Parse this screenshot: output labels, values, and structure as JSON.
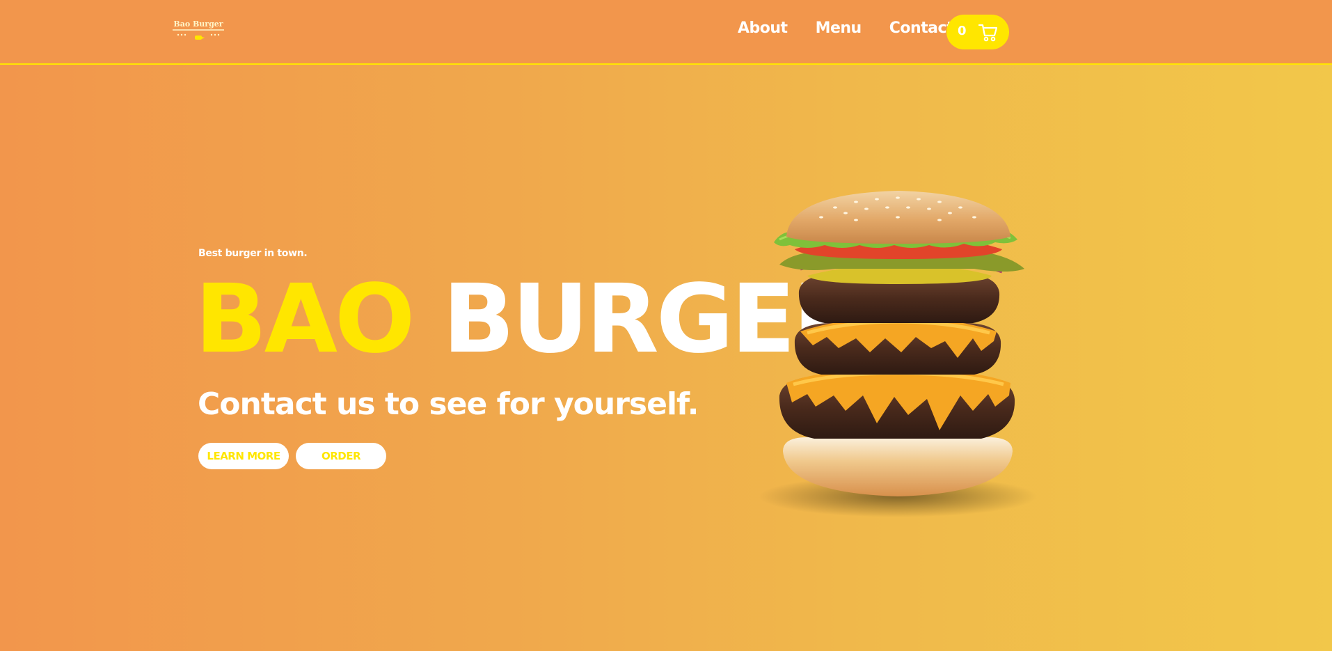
{
  "header": {
    "logo_text": "Bao Burger",
    "nav": [
      {
        "label": "About"
      },
      {
        "label": "Menu"
      },
      {
        "label": "Contact"
      }
    ],
    "cart": {
      "count": "0",
      "icon": "cart-icon"
    }
  },
  "hero": {
    "tagline": "Best burger in town.",
    "title_part1": "BAO",
    "title_part2": "BURGER",
    "subheading": "Contact us to see for yourself.",
    "buttons": {
      "learn_more": "LEARN MORE",
      "order": "ORDER"
    },
    "image": "burger-image"
  },
  "colors": {
    "accent_yellow": "#ffe600",
    "orange": "#f2964c",
    "white": "#ffffff"
  }
}
